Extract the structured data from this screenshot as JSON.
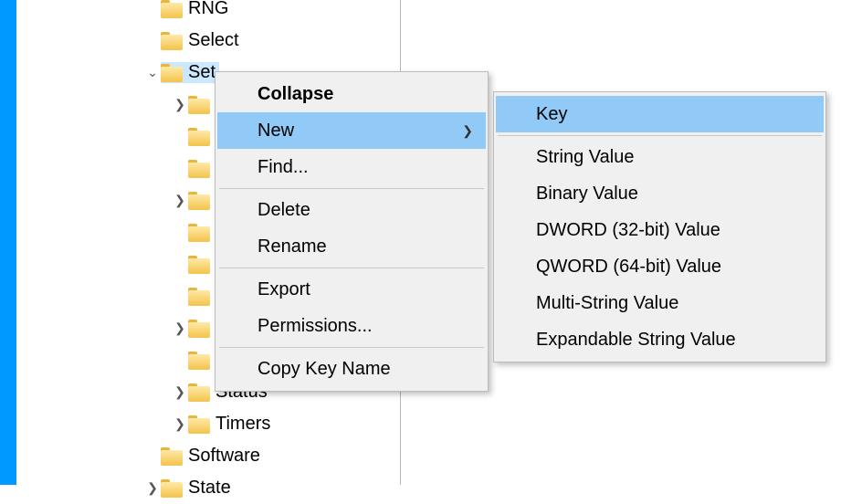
{
  "tree": {
    "level0": [
      {
        "label": "RNG",
        "exp": ""
      },
      {
        "label": "Select",
        "exp": ""
      },
      {
        "label": "Set",
        "exp": "down",
        "selected": true
      }
    ],
    "level1_hidden_count": 8,
    "level1_visible": [
      {
        "label": "Status",
        "exp": "right"
      },
      {
        "label": "Timers",
        "exp": "right"
      }
    ],
    "level0_tail": [
      {
        "label": "Software",
        "exp": ""
      },
      {
        "label": "State",
        "exp": "right"
      }
    ]
  },
  "contextMenu": {
    "collapse": "Collapse",
    "new": "New",
    "find": "Find...",
    "delete": "Delete",
    "rename": "Rename",
    "export": "Export",
    "permissions": "Permissions...",
    "copyKeyName": "Copy Key Name"
  },
  "newSubmenu": {
    "key": "Key",
    "stringValue": "String Value",
    "binaryValue": "Binary Value",
    "dword": "DWORD (32-bit) Value",
    "qword": "QWORD (64-bit) Value",
    "multiString": "Multi-String Value",
    "expandable": "Expandable String Value"
  }
}
